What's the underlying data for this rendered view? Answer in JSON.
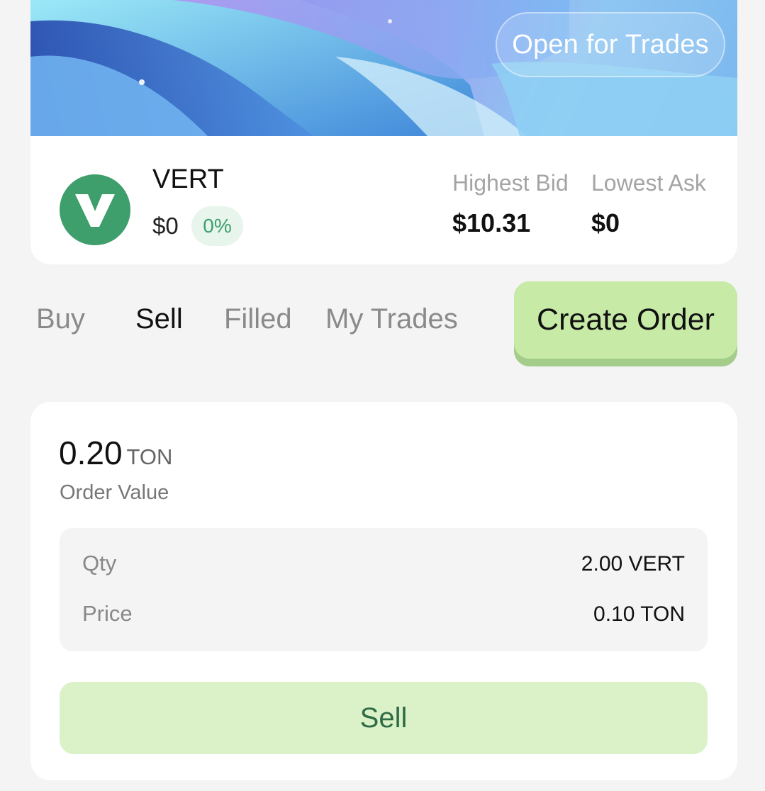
{
  "banner": {
    "status_badge": "Open for Trades"
  },
  "token": {
    "symbol": "VERT",
    "price": "$0",
    "change": "0%",
    "logo_icon": "vert-logo-icon",
    "logo_color": "#3e9e6c"
  },
  "stats": {
    "highest_bid_label": "Highest Bid",
    "highest_bid_value": "$10.31",
    "lowest_ask_label": "Lowest Ask",
    "lowest_ask_value": "$0"
  },
  "tabs": [
    {
      "label": "Buy",
      "active": false
    },
    {
      "label": "Sell",
      "active": true
    },
    {
      "label": "Filled",
      "active": false
    },
    {
      "label": "My Trades",
      "active": false
    }
  ],
  "create_order_label": "Create Order",
  "order": {
    "value": "0.20",
    "value_unit": "TON",
    "value_label": "Order Value",
    "qty_label": "Qty",
    "qty_value": "2.00 VERT",
    "price_label": "Price",
    "price_value": "0.10 TON",
    "action_label": "Sell"
  },
  "colors": {
    "accent_green": "#3e9e6c",
    "create_button": "#c7eba7",
    "sell_button": "#dbf2c8"
  }
}
